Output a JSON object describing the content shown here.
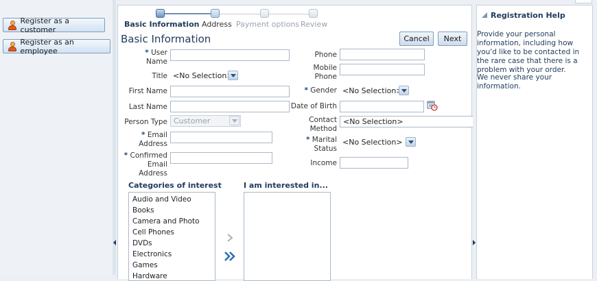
{
  "left_panel": {
    "buttons": [
      {
        "label": "Register as a customer"
      },
      {
        "label": "Register as an employee"
      }
    ]
  },
  "train": {
    "stops": [
      {
        "label": "Basic Information",
        "state": "current"
      },
      {
        "label": "Address",
        "state": "visited"
      },
      {
        "label": "Payment options",
        "state": "pending"
      },
      {
        "label": "Review",
        "state": "pending"
      }
    ]
  },
  "page_title": "Basic Information",
  "actions": {
    "cancel": "Cancel",
    "next": "Next"
  },
  "form": {
    "required_marker": "*",
    "user_name": {
      "label_line1": "User",
      "label_line2": "Name",
      "value": ""
    },
    "title": {
      "label": "Title",
      "value": "<No Selection>"
    },
    "first_name": {
      "label": "First Name",
      "value": ""
    },
    "last_name": {
      "label": "Last Name",
      "value": ""
    },
    "person_type": {
      "label": "Person Type",
      "value": "Customer"
    },
    "email": {
      "label_line1": "Email",
      "label_line2": "Address",
      "value": ""
    },
    "confirmed_email": {
      "label_line1": "Confirmed",
      "label_line2": "Email",
      "label_line3": "Address",
      "value": ""
    },
    "phone": {
      "label": "Phone",
      "value": ""
    },
    "mobile_phone": {
      "label_line1": "Mobile",
      "label_line2": "Phone",
      "value": ""
    },
    "gender": {
      "label": "Gender",
      "value": "<No Selection>"
    },
    "date_of_birth": {
      "label": "Date of Birth",
      "value": ""
    },
    "contact_method": {
      "label_line1": "Contact",
      "label_line2": "Method",
      "value": "<No Selection>"
    },
    "marital_status": {
      "label_line1": "Marital",
      "label_line2": "Status",
      "value": "<No Selection>"
    },
    "income": {
      "label": "Income",
      "value": ""
    }
  },
  "shuttle": {
    "available_title": "Categories of interest",
    "selected_title": "I am interested in...",
    "available_items": [
      "Audio and Video",
      "Books",
      "Camera and Photo",
      "Cell Phones",
      "DVDs",
      "Electronics",
      "Games",
      "Hardware"
    ]
  },
  "help": {
    "title": "Registration Help",
    "paragraph1": "Provide your personal information, including how you'd like to be contacted in the rare case that there is a problem with your order.",
    "paragraph2": "We never share your information."
  }
}
